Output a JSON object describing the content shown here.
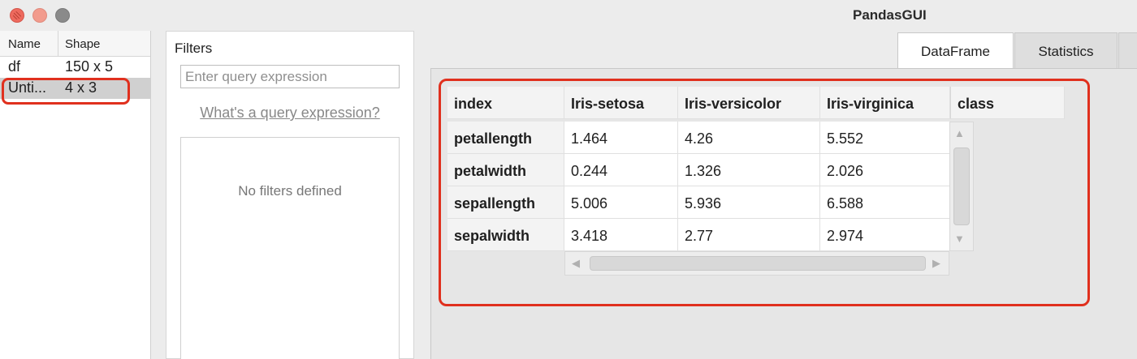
{
  "window": {
    "title": "PandasGUI"
  },
  "dataframes": {
    "headers": {
      "name": "Name",
      "shape": "Shape"
    },
    "rows": [
      {
        "name": "df",
        "shape": "150 x 5"
      },
      {
        "name": "Unti...",
        "shape": "4 x 3"
      }
    ],
    "selected_index": 1
  },
  "filters": {
    "title": "Filters",
    "input_placeholder": "Enter query expression",
    "help_link": "What's a query expression?",
    "empty_text": "No filters defined"
  },
  "tabs": [
    {
      "label": "DataFrame",
      "active": true
    },
    {
      "label": "Statistics",
      "active": false
    }
  ],
  "table": {
    "columns": [
      "index",
      "Iris-setosa",
      "Iris-versicolor",
      "Iris-virginica",
      "class"
    ],
    "rows": [
      {
        "index": "petallength",
        "values": [
          "1.464",
          "4.26",
          "5.552"
        ]
      },
      {
        "index": "petalwidth",
        "values": [
          "0.244",
          "1.326",
          "2.026"
        ]
      },
      {
        "index": "sepallength",
        "values": [
          "5.006",
          "5.936",
          "6.588"
        ]
      },
      {
        "index": "sepalwidth",
        "values": [
          "3.418",
          "2.77",
          "2.974"
        ]
      }
    ]
  },
  "colors": {
    "highlight": "#e0301e",
    "selected_row": "#d0d0d0",
    "window_bg": "#ececec"
  }
}
